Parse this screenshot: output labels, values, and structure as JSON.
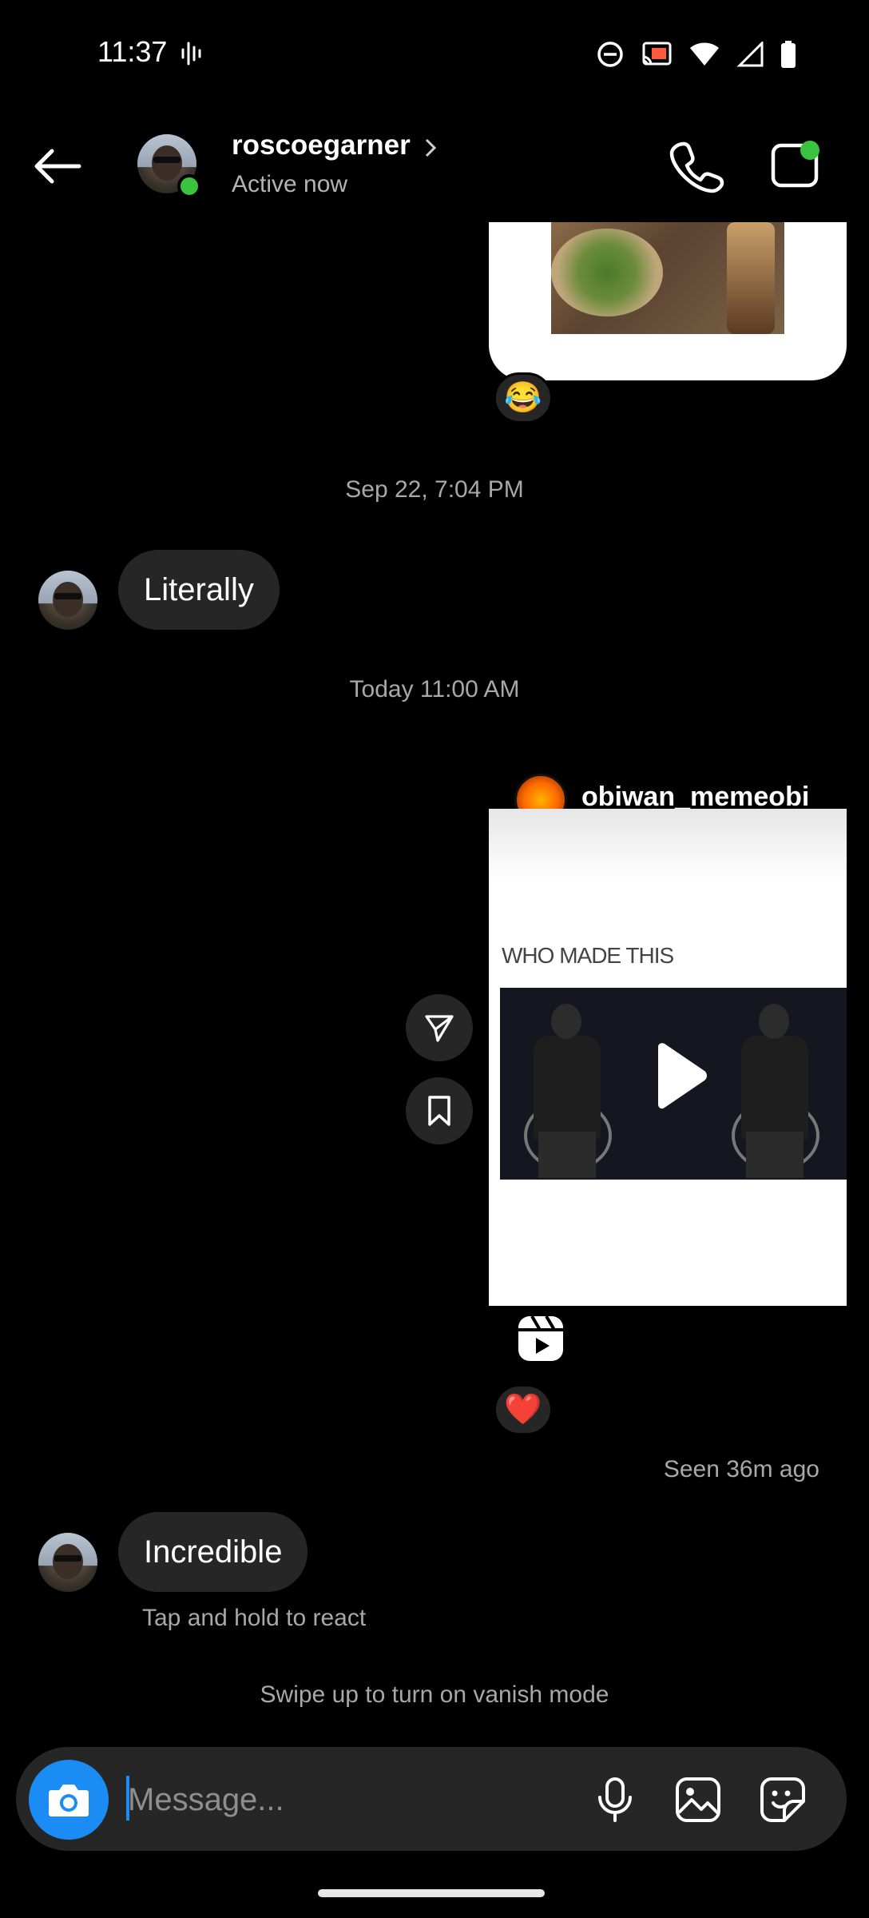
{
  "status_bar": {
    "time": "11:37",
    "icons": [
      "sound-wave-icon",
      "do-not-disturb-icon",
      "cast-icon",
      "wifi-icon",
      "signal-icon",
      "battery-icon"
    ]
  },
  "header": {
    "username": "roscoegarner",
    "status": "Active now",
    "online_color": "#3ac33f"
  },
  "messages": {
    "photo_reaction": "😂",
    "timestamp_1": "Sep 22, 7:04 PM",
    "bubble_1": "Literally",
    "timestamp_2": "Today 11:00 AM",
    "reel": {
      "username": "obiwan_memeobi",
      "caption": "WHO MADE THIS",
      "reaction": "❤️"
    },
    "seen": "Seen 36m ago",
    "bubble_2": "Incredible",
    "hint": "Tap and hold to react",
    "vanish": "Swipe up to turn on vanish mode"
  },
  "composer": {
    "placeholder": "Message...",
    "accent": "#1a8cf3"
  }
}
